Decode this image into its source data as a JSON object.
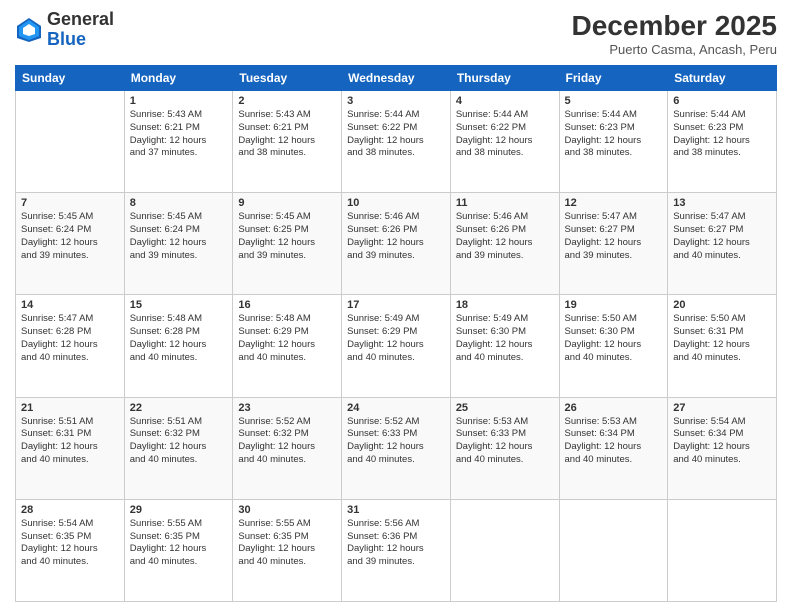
{
  "logo": {
    "general": "General",
    "blue": "Blue"
  },
  "title": "December 2025",
  "subtitle": "Puerto Casma, Ancash, Peru",
  "days": [
    "Sunday",
    "Monday",
    "Tuesday",
    "Wednesday",
    "Thursday",
    "Friday",
    "Saturday"
  ],
  "weeks": [
    [
      {
        "day": null,
        "info": null
      },
      {
        "day": "1",
        "info": "Sunrise: 5:43 AM\nSunset: 6:21 PM\nDaylight: 12 hours\nand 37 minutes."
      },
      {
        "day": "2",
        "info": "Sunrise: 5:43 AM\nSunset: 6:21 PM\nDaylight: 12 hours\nand 38 minutes."
      },
      {
        "day": "3",
        "info": "Sunrise: 5:44 AM\nSunset: 6:22 PM\nDaylight: 12 hours\nand 38 minutes."
      },
      {
        "day": "4",
        "info": "Sunrise: 5:44 AM\nSunset: 6:22 PM\nDaylight: 12 hours\nand 38 minutes."
      },
      {
        "day": "5",
        "info": "Sunrise: 5:44 AM\nSunset: 6:23 PM\nDaylight: 12 hours\nand 38 minutes."
      },
      {
        "day": "6",
        "info": "Sunrise: 5:44 AM\nSunset: 6:23 PM\nDaylight: 12 hours\nand 38 minutes."
      }
    ],
    [
      {
        "day": "7",
        "info": "Sunrise: 5:45 AM\nSunset: 6:24 PM\nDaylight: 12 hours\nand 39 minutes."
      },
      {
        "day": "8",
        "info": "Sunrise: 5:45 AM\nSunset: 6:24 PM\nDaylight: 12 hours\nand 39 minutes."
      },
      {
        "day": "9",
        "info": "Sunrise: 5:45 AM\nSunset: 6:25 PM\nDaylight: 12 hours\nand 39 minutes."
      },
      {
        "day": "10",
        "info": "Sunrise: 5:46 AM\nSunset: 6:26 PM\nDaylight: 12 hours\nand 39 minutes."
      },
      {
        "day": "11",
        "info": "Sunrise: 5:46 AM\nSunset: 6:26 PM\nDaylight: 12 hours\nand 39 minutes."
      },
      {
        "day": "12",
        "info": "Sunrise: 5:47 AM\nSunset: 6:27 PM\nDaylight: 12 hours\nand 39 minutes."
      },
      {
        "day": "13",
        "info": "Sunrise: 5:47 AM\nSunset: 6:27 PM\nDaylight: 12 hours\nand 40 minutes."
      }
    ],
    [
      {
        "day": "14",
        "info": "Sunrise: 5:47 AM\nSunset: 6:28 PM\nDaylight: 12 hours\nand 40 minutes."
      },
      {
        "day": "15",
        "info": "Sunrise: 5:48 AM\nSunset: 6:28 PM\nDaylight: 12 hours\nand 40 minutes."
      },
      {
        "day": "16",
        "info": "Sunrise: 5:48 AM\nSunset: 6:29 PM\nDaylight: 12 hours\nand 40 minutes."
      },
      {
        "day": "17",
        "info": "Sunrise: 5:49 AM\nSunset: 6:29 PM\nDaylight: 12 hours\nand 40 minutes."
      },
      {
        "day": "18",
        "info": "Sunrise: 5:49 AM\nSunset: 6:30 PM\nDaylight: 12 hours\nand 40 minutes."
      },
      {
        "day": "19",
        "info": "Sunrise: 5:50 AM\nSunset: 6:30 PM\nDaylight: 12 hours\nand 40 minutes."
      },
      {
        "day": "20",
        "info": "Sunrise: 5:50 AM\nSunset: 6:31 PM\nDaylight: 12 hours\nand 40 minutes."
      }
    ],
    [
      {
        "day": "21",
        "info": "Sunrise: 5:51 AM\nSunset: 6:31 PM\nDaylight: 12 hours\nand 40 minutes."
      },
      {
        "day": "22",
        "info": "Sunrise: 5:51 AM\nSunset: 6:32 PM\nDaylight: 12 hours\nand 40 minutes."
      },
      {
        "day": "23",
        "info": "Sunrise: 5:52 AM\nSunset: 6:32 PM\nDaylight: 12 hours\nand 40 minutes."
      },
      {
        "day": "24",
        "info": "Sunrise: 5:52 AM\nSunset: 6:33 PM\nDaylight: 12 hours\nand 40 minutes."
      },
      {
        "day": "25",
        "info": "Sunrise: 5:53 AM\nSunset: 6:33 PM\nDaylight: 12 hours\nand 40 minutes."
      },
      {
        "day": "26",
        "info": "Sunrise: 5:53 AM\nSunset: 6:34 PM\nDaylight: 12 hours\nand 40 minutes."
      },
      {
        "day": "27",
        "info": "Sunrise: 5:54 AM\nSunset: 6:34 PM\nDaylight: 12 hours\nand 40 minutes."
      }
    ],
    [
      {
        "day": "28",
        "info": "Sunrise: 5:54 AM\nSunset: 6:35 PM\nDaylight: 12 hours\nand 40 minutes."
      },
      {
        "day": "29",
        "info": "Sunrise: 5:55 AM\nSunset: 6:35 PM\nDaylight: 12 hours\nand 40 minutes."
      },
      {
        "day": "30",
        "info": "Sunrise: 5:55 AM\nSunset: 6:35 PM\nDaylight: 12 hours\nand 40 minutes."
      },
      {
        "day": "31",
        "info": "Sunrise: 5:56 AM\nSunset: 6:36 PM\nDaylight: 12 hours\nand 39 minutes."
      },
      {
        "day": null,
        "info": null
      },
      {
        "day": null,
        "info": null
      },
      {
        "day": null,
        "info": null
      }
    ]
  ]
}
